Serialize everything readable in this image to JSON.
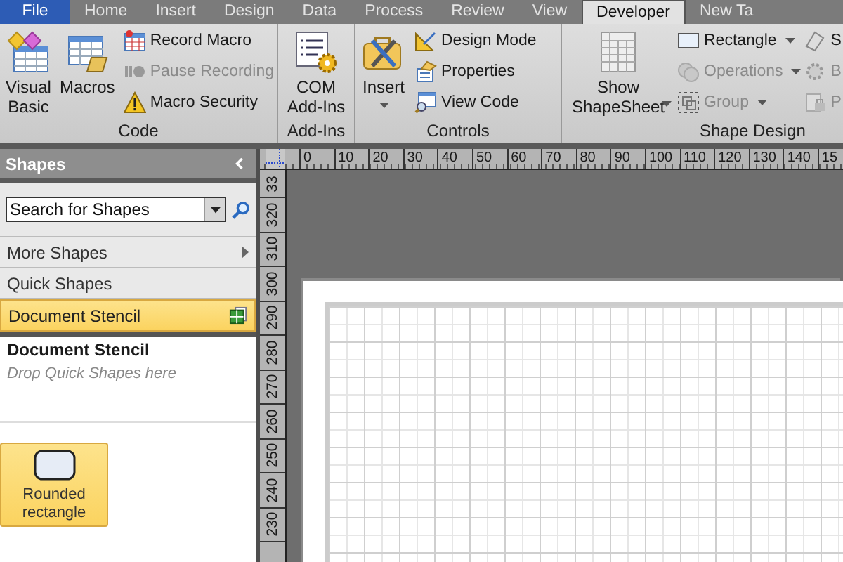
{
  "tabs": [
    {
      "label": "File",
      "kind": "file",
      "selected": false
    },
    {
      "label": "Home",
      "kind": "tab",
      "selected": false
    },
    {
      "label": "Insert",
      "kind": "tab",
      "selected": false
    },
    {
      "label": "Design",
      "kind": "tab",
      "selected": false
    },
    {
      "label": "Data",
      "kind": "tab",
      "selected": false
    },
    {
      "label": "Process",
      "kind": "tab",
      "selected": false
    },
    {
      "label": "Review",
      "kind": "tab",
      "selected": false
    },
    {
      "label": "View",
      "kind": "tab",
      "selected": false
    },
    {
      "label": "Developer",
      "kind": "tab",
      "selected": true
    },
    {
      "label": "New Ta",
      "kind": "tab",
      "selected": false
    }
  ],
  "ribbon_groups": [
    {
      "label": "Code",
      "large": [
        {
          "label": "Visual Basic",
          "dropdown": false
        },
        {
          "label": "Macros",
          "dropdown": false
        }
      ],
      "columns": [
        [
          {
            "label": "Record Macro",
            "disabled": false,
            "dropdown": false
          },
          {
            "label": "Pause Recording",
            "disabled": true,
            "dropdown": false
          },
          {
            "label": "Macro Security",
            "disabled": false,
            "dropdown": false
          }
        ]
      ]
    },
    {
      "label": "Add-Ins",
      "large": [
        {
          "label": "COM Add-Ins",
          "dropdown": false
        }
      ]
    },
    {
      "label": "Controls",
      "large": [
        {
          "label": "Insert",
          "dropdown": true
        }
      ],
      "columns": [
        [
          {
            "label": "Design Mode",
            "disabled": false,
            "dropdown": false
          },
          {
            "label": "Properties",
            "disabled": false,
            "dropdown": false
          },
          {
            "label": "View Code",
            "disabled": false,
            "dropdown": false
          }
        ]
      ]
    },
    {
      "label": "Shape Design",
      "large": [
        {
          "label": "Show ShapeSheet",
          "dropdown": true
        }
      ],
      "columns": [
        [
          {
            "label": "Rectangle",
            "disabled": false,
            "dropdown": true
          },
          {
            "label": "Operations",
            "disabled": true,
            "dropdown": true
          },
          {
            "label": "Group",
            "disabled": true,
            "dropdown": true
          }
        ],
        [
          {
            "label": "S",
            "disabled": false,
            "dropdown": false
          },
          {
            "label": "B",
            "disabled": true,
            "dropdown": false
          },
          {
            "label": "P",
            "disabled": true,
            "dropdown": false
          }
        ]
      ]
    }
  ],
  "shapes_pane": {
    "title": "Shapes",
    "search": {
      "placeholder": "Search for Shapes"
    },
    "nav": [
      {
        "label": "More Shapes",
        "kind": "submenu",
        "selected": false
      },
      {
        "label": "Quick Shapes",
        "kind": "plain",
        "selected": false
      },
      {
        "label": "Document Stencil",
        "kind": "stencil",
        "selected": true
      }
    ],
    "stencil_title": "Document Stencil",
    "stencil_hint": "Drop Quick Shapes here",
    "shapes": [
      {
        "label": "Rounded rectangle",
        "selected": true
      }
    ]
  },
  "ruler": {
    "horizontal": [
      "0",
      "10",
      "20",
      "30",
      "40",
      "50",
      "60",
      "70",
      "80",
      "90",
      "100",
      "110",
      "120",
      "130",
      "140",
      "15"
    ],
    "vertical": [
      "33",
      "320",
      "310",
      "300",
      "290",
      "280",
      "270",
      "260",
      "250",
      "240",
      "230"
    ]
  }
}
